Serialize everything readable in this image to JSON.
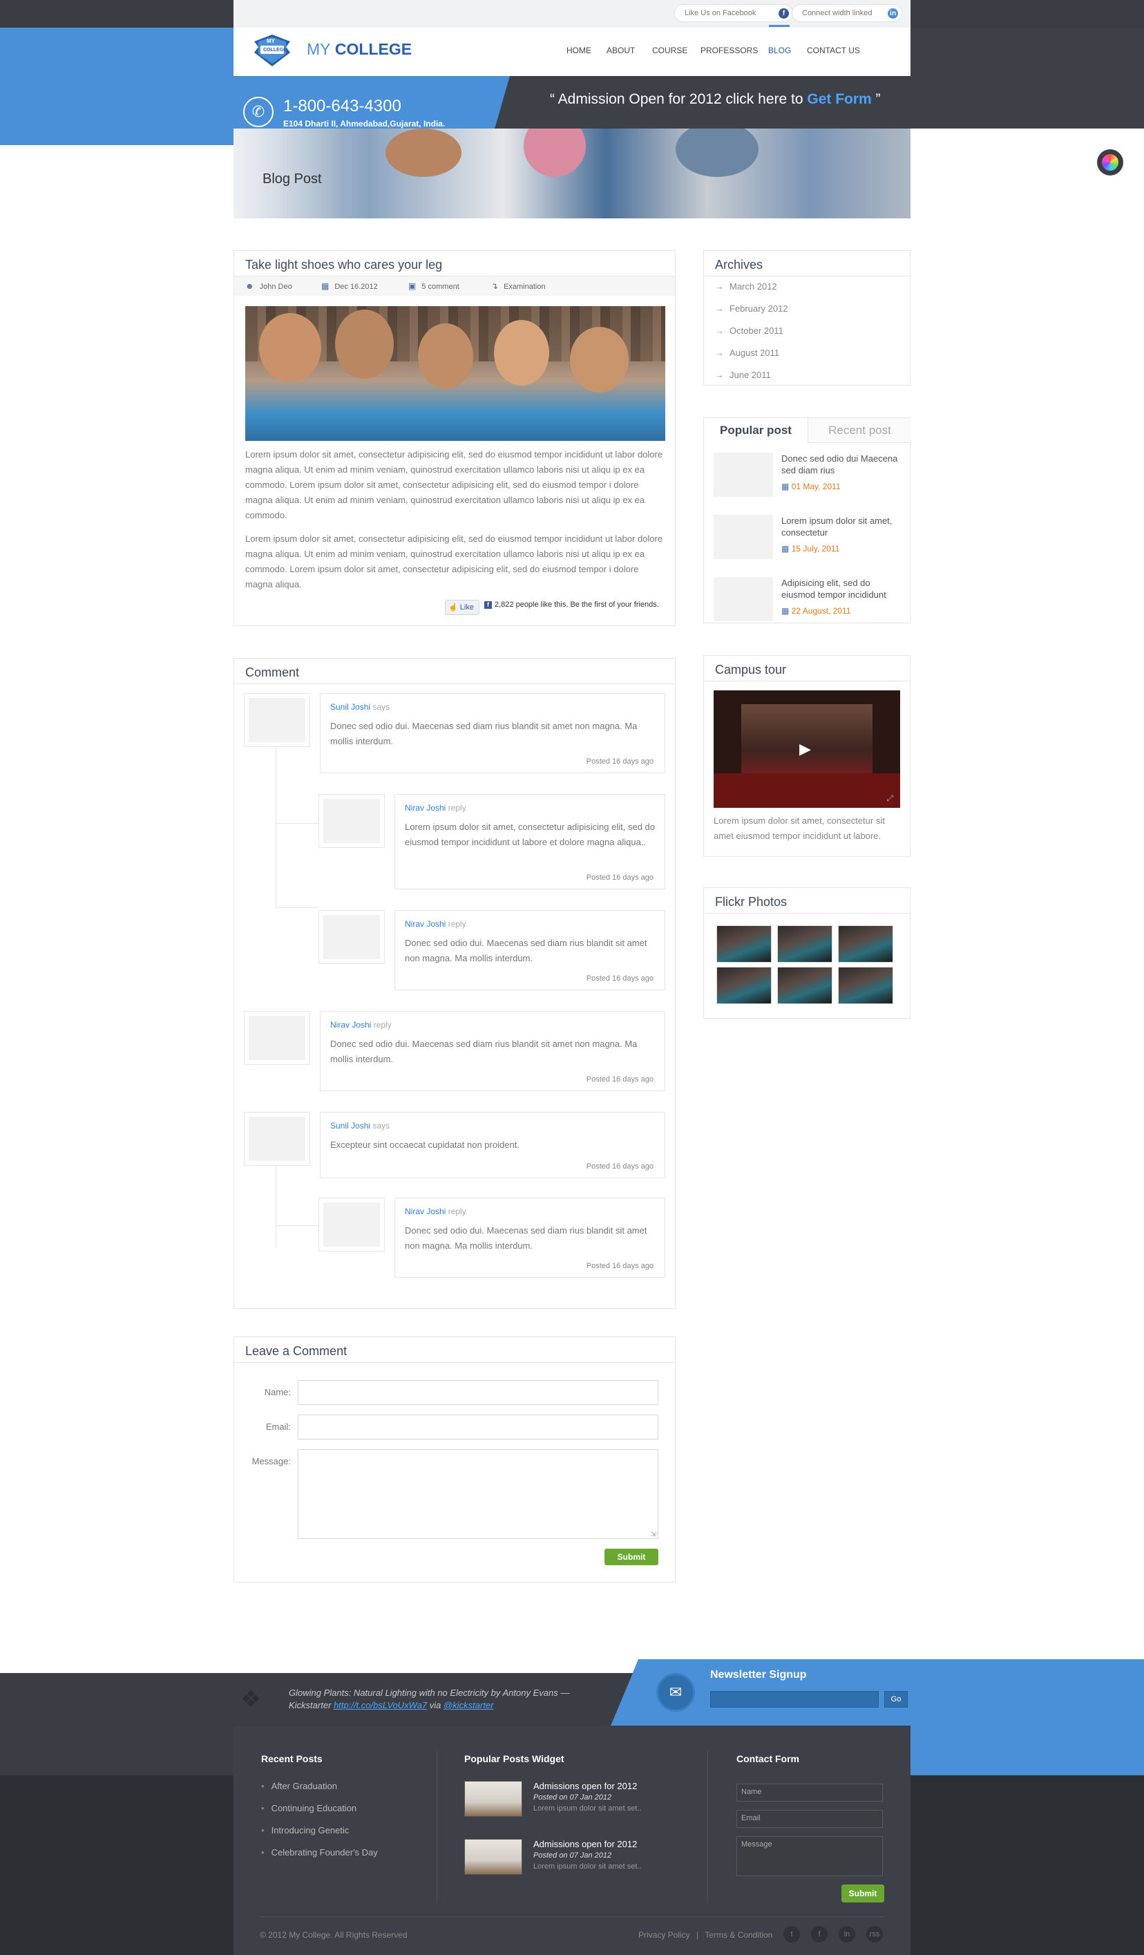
{
  "topbar": {
    "facebook_label": "Like Us on Facebook",
    "facebook_icon": "f",
    "linkedin_label": "Connect width linked",
    "linkedin_icon": "in"
  },
  "header": {
    "logo_badge_top": "MY",
    "logo_badge_bottom": "COLLEGE",
    "logo_my": "MY",
    "logo_college": "COLLEGE",
    "nav": [
      "HOME",
      "ABOUT",
      "COURSE",
      "PROFESSORS",
      "BLOG",
      "CONTACT US"
    ],
    "active_nav": "BLOG"
  },
  "contact": {
    "phone": "1-800-643-4300",
    "address": "E104 Dharti II, Ahmedabad,Gujarat, India."
  },
  "admission": {
    "prefix": "“ Admission Open for 2012 click here to",
    "link": "Get Form",
    "suffix": "”"
  },
  "hero": {
    "title": "Blog Post"
  },
  "post": {
    "title": "Take light shoes who cares your leg",
    "author": "John Deo",
    "date": "Dec 16.2012",
    "comments": "5 comment",
    "category": "Examination",
    "para1": "Lorem ipsum dolor sit amet, consectetur adipisicing elit, sed do eiusmod tempor incididunt ut labor dolore magna aliqua. Ut enim ad minim veniam, quinostrud exercitation ullamco laboris nisi ut aliqu ip ex ea commodo. Lorem ipsum dolor sit amet, consectetur adipisicing elit, sed do eiusmod tempor i dolore magna aliqua. Ut enim ad minim veniam, quinostrud exercitation ullamco laboris nisi ut aliqu ip ex ea commodo.",
    "para2": "Lorem ipsum dolor sit amet, consectetur adipisicing elit, sed do eiusmod tempor incididunt ut labor dolore magna aliqua. Ut enim ad minim veniam, quinostrud exercitation ullamco laboris nisi ut aliqu ip ex ea commodo. Lorem ipsum dolor sit amet, consectetur adipisicing elit, sed do eiusmod tempor i dolore magna aliqua.",
    "like_button": "Like",
    "like_text": "2,822 people like this. Be the first of your friends."
  },
  "comments": {
    "title": "Comment",
    "items": [
      {
        "name": "Sunil Joshi",
        "verb": "says",
        "text": "Donec sed odio dui. Maecenas sed diam rius blandit sit amet non magna. Ma mollis interdum.",
        "date": "Posted 16 days ago"
      },
      {
        "name": "Nirav Joshi",
        "verb": "reply",
        "text": "Lorem ipsum dolor sit amet, consectetur adipisicing elit, sed do eiusmod tempor incididunt ut labore et dolore magna aliqua..",
        "date": "Posted 16 days ago"
      },
      {
        "name": "Nirav Joshi",
        "verb": "reply",
        "text": "Donec sed odio dui. Maecenas sed diam rius blandit sit amet non magna. Ma mollis interdum.",
        "date": "Posted 16 days ago"
      },
      {
        "name": "Nirav Joshi",
        "verb": "reply",
        "text": "Donec sed odio dui. Maecenas sed diam rius blandit sit amet non magna. Ma mollis interdum.",
        "date": "Posted 16 days ago"
      },
      {
        "name": "Sunil Joshi",
        "verb": "says",
        "text": "Excepteur sint occaecat cupidatat non proident.",
        "date": "Posted 16 days ago"
      },
      {
        "name": "Nirav Joshi",
        "verb": "reply",
        "text": "Donec sed odio dui. Maecenas sed diam rius blandit sit amet non magna. Ma mollis interdum.",
        "date": "Posted 16 days ago"
      }
    ]
  },
  "leave_comment": {
    "title": "Leave a Comment",
    "name_label": "Name:",
    "email_label": "Email:",
    "message_label": "Message:",
    "submit": "Submit"
  },
  "archives": {
    "title": "Archives",
    "items": [
      "March 2012",
      "February 2012",
      "October 2011",
      "August 2011",
      "June 2011"
    ]
  },
  "popular": {
    "tab_popular": "Popular post",
    "tab_recent": "Recent post",
    "items": [
      {
        "title": "Donec sed odio dui Maecena sed diam rius",
        "date": "01 May, 2011"
      },
      {
        "title": "Lorem ipsum dolor sit amet, consectetur",
        "date": "15 July, 2011"
      },
      {
        "title": "Adipisicing elit, sed do eiusmod tempor incididunt",
        "date": "22 August, 2011"
      }
    ]
  },
  "campus": {
    "title": "Campus tour",
    "text": "Lorem ipsum dolor sit amet, consectetur sit amet eiusmod tempor incididunt ut labore."
  },
  "flickr": {
    "title": "Flickr Photos"
  },
  "twitter": {
    "text": "Glowing Plants: Natural Lighting with no Electricity by Antony Evans — Kickstarter",
    "link": "http://t.co/bsLVoUxWa7",
    "via": "via",
    "handle": "@kickstarter"
  },
  "newsletter": {
    "title": "Newsletter Signup",
    "go": "Go"
  },
  "footer": {
    "recent_title": "Recent Posts",
    "recent_items": [
      "After Graduation",
      "Continuing Education",
      "Introducing Genetic",
      "Celebrating Founder's Day"
    ],
    "widget_title": "Popular Posts Widget",
    "widget_items": [
      {
        "title": "Admissions open for 2012",
        "date": "Posted on 07 Jan 2012",
        "text": "Lorem ipsum dolor sit amet set.."
      },
      {
        "title": "Admissions open for 2012",
        "date": "Posted on 07 Jan 2012",
        "text": "Lorem ipsum dolor sit amet set.."
      }
    ],
    "contact_title": "Contact Form",
    "contact_name": "Name",
    "contact_email": "Email",
    "contact_message": "Message",
    "contact_submit": "Submit",
    "copyright": "© 2012 My College. All Rights Reserved",
    "privacy": "Privacy Policy",
    "sep": "|",
    "terms": "Terms & Condition",
    "social": [
      "t",
      "f",
      "in",
      "rss"
    ]
  },
  "colors": {
    "accent_blue": "#4a90d9",
    "dark": "#3d4046",
    "link_blue": "#2f7fd1",
    "green": "#6aa832",
    "orange": "#e07a1a"
  }
}
